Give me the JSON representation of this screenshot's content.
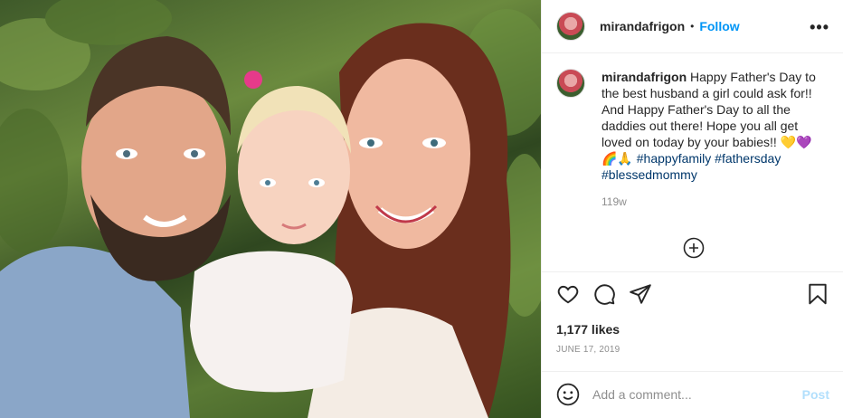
{
  "post": {
    "photo_alt": "Family photo"
  },
  "header": {
    "username": "mirandafrigon",
    "separator": "•",
    "follow_label": "Follow",
    "more_label": "•••"
  },
  "caption": {
    "username": "mirandafrigon",
    "text": "Happy Father's Day to the best husband a girl could ask for!! And Happy Father's Day to all the daddies out there! Hope you all get loved on today by your babies!! 💛💜 🌈🙏",
    "hashtags": [
      "#happyfamily",
      "#fathersday",
      "#blessedmommy"
    ],
    "time_ago": "119w"
  },
  "actions": {
    "like_icon": "heart-icon",
    "comment_icon": "comment-icon",
    "share_icon": "paper-plane-icon",
    "save_icon": "bookmark-icon",
    "load_more_icon": "plus-circle-icon"
  },
  "stats": {
    "likes": "1,177 likes",
    "date": "JUNE 17, 2019"
  },
  "comment": {
    "placeholder": "Add a comment...",
    "post_label": "Post",
    "emoji_icon": "smiley-icon"
  },
  "colors": {
    "link_blue": "#0095f6",
    "hashtag_blue": "#00376b",
    "post_disabled": "#b2dffc",
    "muted": "#8e8e8e"
  }
}
